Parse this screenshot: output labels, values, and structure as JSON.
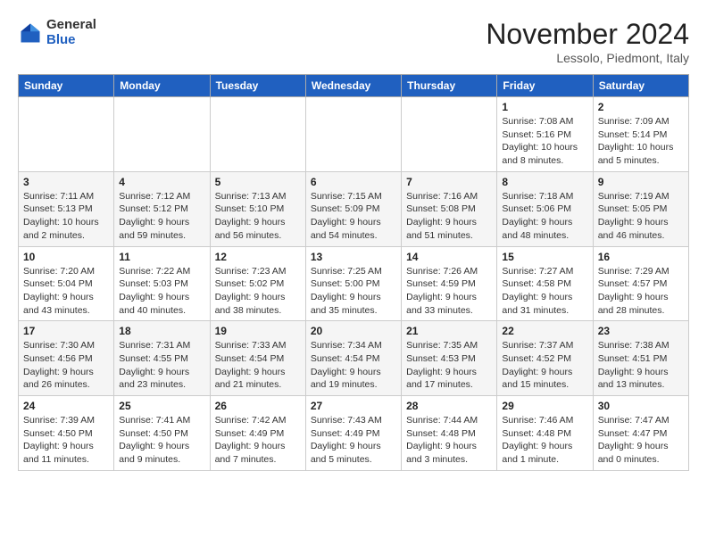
{
  "header": {
    "logo_general": "General",
    "logo_blue": "Blue",
    "month_title": "November 2024",
    "location": "Lessolo, Piedmont, Italy"
  },
  "days_of_week": [
    "Sunday",
    "Monday",
    "Tuesday",
    "Wednesday",
    "Thursday",
    "Friday",
    "Saturday"
  ],
  "weeks": [
    [
      {
        "day": "",
        "info": ""
      },
      {
        "day": "",
        "info": ""
      },
      {
        "day": "",
        "info": ""
      },
      {
        "day": "",
        "info": ""
      },
      {
        "day": "",
        "info": ""
      },
      {
        "day": "1",
        "info": "Sunrise: 7:08 AM\nSunset: 5:16 PM\nDaylight: 10 hours\nand 8 minutes."
      },
      {
        "day": "2",
        "info": "Sunrise: 7:09 AM\nSunset: 5:14 PM\nDaylight: 10 hours\nand 5 minutes."
      }
    ],
    [
      {
        "day": "3",
        "info": "Sunrise: 7:11 AM\nSunset: 5:13 PM\nDaylight: 10 hours\nand 2 minutes."
      },
      {
        "day": "4",
        "info": "Sunrise: 7:12 AM\nSunset: 5:12 PM\nDaylight: 9 hours\nand 59 minutes."
      },
      {
        "day": "5",
        "info": "Sunrise: 7:13 AM\nSunset: 5:10 PM\nDaylight: 9 hours\nand 56 minutes."
      },
      {
        "day": "6",
        "info": "Sunrise: 7:15 AM\nSunset: 5:09 PM\nDaylight: 9 hours\nand 54 minutes."
      },
      {
        "day": "7",
        "info": "Sunrise: 7:16 AM\nSunset: 5:08 PM\nDaylight: 9 hours\nand 51 minutes."
      },
      {
        "day": "8",
        "info": "Sunrise: 7:18 AM\nSunset: 5:06 PM\nDaylight: 9 hours\nand 48 minutes."
      },
      {
        "day": "9",
        "info": "Sunrise: 7:19 AM\nSunset: 5:05 PM\nDaylight: 9 hours\nand 46 minutes."
      }
    ],
    [
      {
        "day": "10",
        "info": "Sunrise: 7:20 AM\nSunset: 5:04 PM\nDaylight: 9 hours\nand 43 minutes."
      },
      {
        "day": "11",
        "info": "Sunrise: 7:22 AM\nSunset: 5:03 PM\nDaylight: 9 hours\nand 40 minutes."
      },
      {
        "day": "12",
        "info": "Sunrise: 7:23 AM\nSunset: 5:02 PM\nDaylight: 9 hours\nand 38 minutes."
      },
      {
        "day": "13",
        "info": "Sunrise: 7:25 AM\nSunset: 5:00 PM\nDaylight: 9 hours\nand 35 minutes."
      },
      {
        "day": "14",
        "info": "Sunrise: 7:26 AM\nSunset: 4:59 PM\nDaylight: 9 hours\nand 33 minutes."
      },
      {
        "day": "15",
        "info": "Sunrise: 7:27 AM\nSunset: 4:58 PM\nDaylight: 9 hours\nand 31 minutes."
      },
      {
        "day": "16",
        "info": "Sunrise: 7:29 AM\nSunset: 4:57 PM\nDaylight: 9 hours\nand 28 minutes."
      }
    ],
    [
      {
        "day": "17",
        "info": "Sunrise: 7:30 AM\nSunset: 4:56 PM\nDaylight: 9 hours\nand 26 minutes."
      },
      {
        "day": "18",
        "info": "Sunrise: 7:31 AM\nSunset: 4:55 PM\nDaylight: 9 hours\nand 23 minutes."
      },
      {
        "day": "19",
        "info": "Sunrise: 7:33 AM\nSunset: 4:54 PM\nDaylight: 9 hours\nand 21 minutes."
      },
      {
        "day": "20",
        "info": "Sunrise: 7:34 AM\nSunset: 4:54 PM\nDaylight: 9 hours\nand 19 minutes."
      },
      {
        "day": "21",
        "info": "Sunrise: 7:35 AM\nSunset: 4:53 PM\nDaylight: 9 hours\nand 17 minutes."
      },
      {
        "day": "22",
        "info": "Sunrise: 7:37 AM\nSunset: 4:52 PM\nDaylight: 9 hours\nand 15 minutes."
      },
      {
        "day": "23",
        "info": "Sunrise: 7:38 AM\nSunset: 4:51 PM\nDaylight: 9 hours\nand 13 minutes."
      }
    ],
    [
      {
        "day": "24",
        "info": "Sunrise: 7:39 AM\nSunset: 4:50 PM\nDaylight: 9 hours\nand 11 minutes."
      },
      {
        "day": "25",
        "info": "Sunrise: 7:41 AM\nSunset: 4:50 PM\nDaylight: 9 hours\nand 9 minutes."
      },
      {
        "day": "26",
        "info": "Sunrise: 7:42 AM\nSunset: 4:49 PM\nDaylight: 9 hours\nand 7 minutes."
      },
      {
        "day": "27",
        "info": "Sunrise: 7:43 AM\nSunset: 4:49 PM\nDaylight: 9 hours\nand 5 minutes."
      },
      {
        "day": "28",
        "info": "Sunrise: 7:44 AM\nSunset: 4:48 PM\nDaylight: 9 hours\nand 3 minutes."
      },
      {
        "day": "29",
        "info": "Sunrise: 7:46 AM\nSunset: 4:48 PM\nDaylight: 9 hours\nand 1 minute."
      },
      {
        "day": "30",
        "info": "Sunrise: 7:47 AM\nSunset: 4:47 PM\nDaylight: 9 hours\nand 0 minutes."
      }
    ]
  ]
}
